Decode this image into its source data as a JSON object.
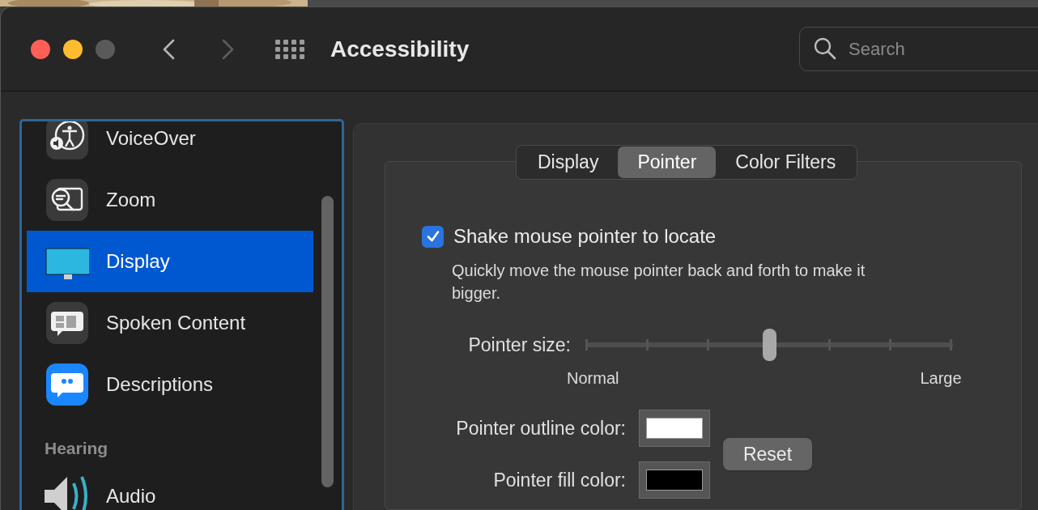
{
  "window": {
    "title": "Accessibility",
    "back_enabled": true,
    "forward_enabled": false
  },
  "search": {
    "placeholder": "Search"
  },
  "sidebar": {
    "items": [
      {
        "kind": "item",
        "label": "VoiceOver",
        "selected": false
      },
      {
        "kind": "item",
        "label": "Zoom",
        "selected": false
      },
      {
        "kind": "item",
        "label": "Display",
        "selected": true
      },
      {
        "kind": "item",
        "label": "Spoken Content",
        "selected": false
      },
      {
        "kind": "item",
        "label": "Descriptions",
        "selected": false
      },
      {
        "kind": "header",
        "label": "Hearing"
      },
      {
        "kind": "item",
        "label": "Audio",
        "selected": false
      }
    ]
  },
  "tabs": [
    {
      "label": "Display",
      "selected": false
    },
    {
      "label": "Pointer",
      "selected": true
    },
    {
      "label": "Color Filters",
      "selected": false
    }
  ],
  "shake": {
    "label": "Shake mouse pointer to locate",
    "checked": true,
    "description": "Quickly move the mouse pointer back and forth to make it bigger."
  },
  "pointer_size": {
    "label": "Pointer size:",
    "level": 0.5,
    "min_label": "Normal",
    "max_label": "Large"
  },
  "color_wells": [
    {
      "label": "Pointer outline color:",
      "color": "#ffffff"
    },
    {
      "label": "Pointer fill color:",
      "color": "#000000"
    }
  ],
  "reset_button": "Reset"
}
